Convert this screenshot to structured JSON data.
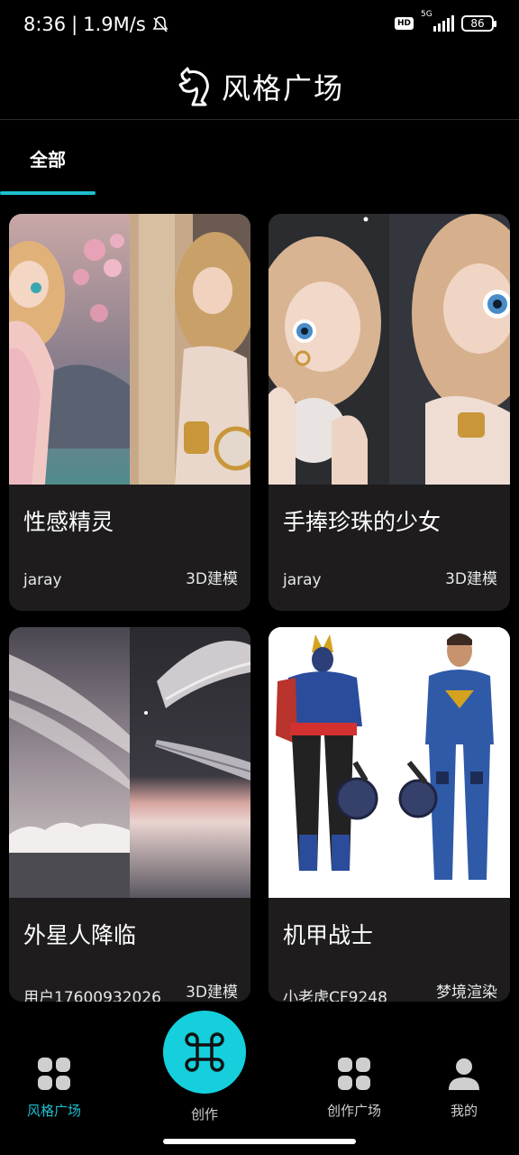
{
  "status_bar": {
    "time": "8:36",
    "net_speed": "1.9M/s",
    "network_type": "5G",
    "hd_label": "HD",
    "battery": "86"
  },
  "header": {
    "title": "风格广场"
  },
  "tabs": [
    {
      "label": "全部",
      "active": true
    }
  ],
  "cards": [
    {
      "title": "性感精灵",
      "author": "jaray",
      "tag": "3D建模"
    },
    {
      "title": "手捧珍珠的少女",
      "author": "jaray",
      "tag": "3D建模"
    },
    {
      "title": "外星人降临",
      "author": "用户17600932026",
      "tag": "3D建模"
    },
    {
      "title": "机甲战士",
      "author": "小老虎CF9248",
      "tag": "梦境渲染"
    }
  ],
  "bottom_nav": {
    "items": [
      {
        "label": "风格广场",
        "icon": "grid-icon",
        "active": true
      },
      {
        "label": "创作",
        "icon": "command-icon",
        "active": false
      },
      {
        "label": "创作广场",
        "icon": "grid-icon",
        "active": false
      },
      {
        "label": "我的",
        "icon": "user-icon",
        "active": false
      }
    ]
  },
  "colors": {
    "accent": "#1dbfd0",
    "fab": "#16cfdc",
    "card_bg": "#1e1c1d"
  }
}
